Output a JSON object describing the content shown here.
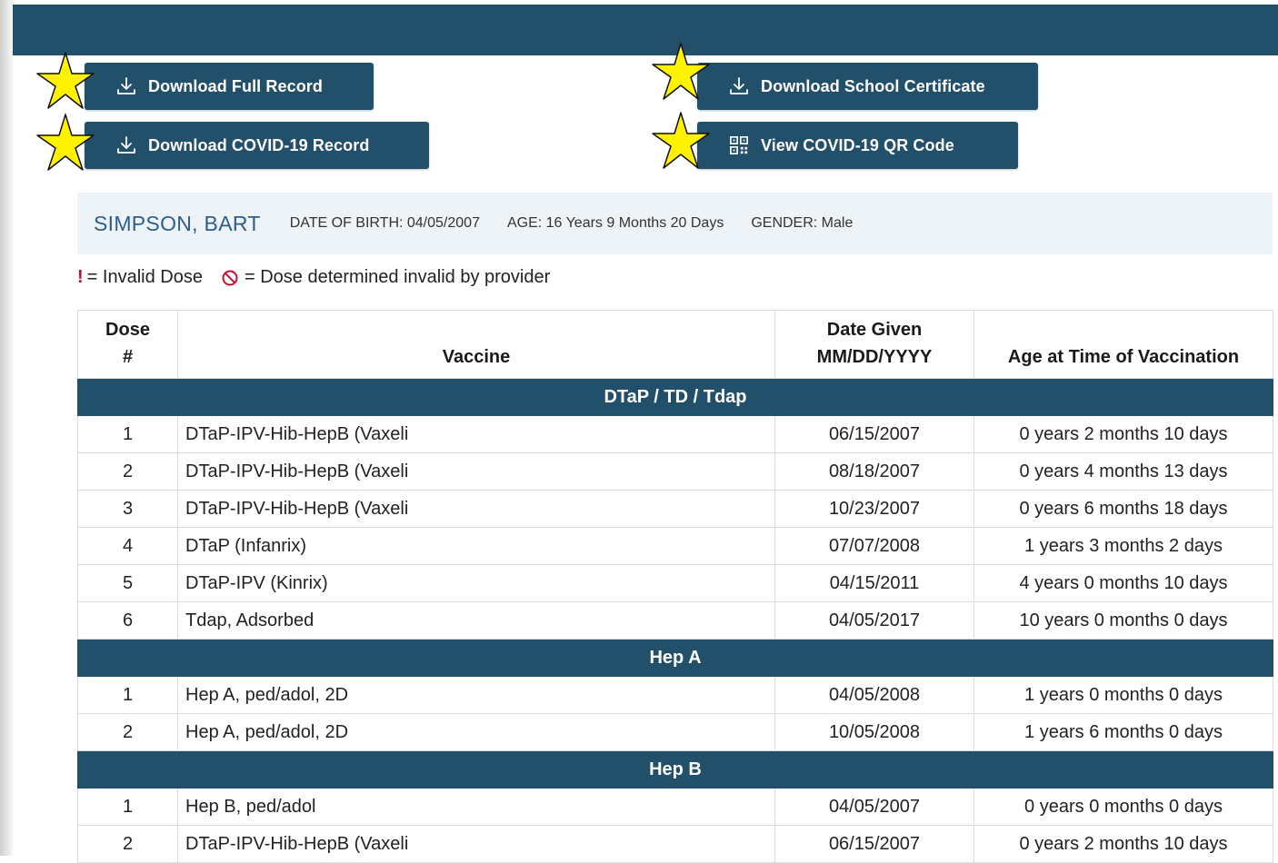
{
  "actions": {
    "download_full": "Download Full Record",
    "download_school": "Download School Certificate",
    "download_covid": "Download COVID-19 Record",
    "view_qr": "View COVID-19 QR Code"
  },
  "patient": {
    "name": "SIMPSON, BART",
    "dob": "DATE OF BIRTH: 04/05/2007",
    "age": "AGE: 16 Years 9 Months 20 Days",
    "gender": "GENDER: Male"
  },
  "legend": {
    "invalid_symbol": "!",
    "invalid_text": "= Invalid Dose",
    "provider_text": "= Dose determined invalid by provider"
  },
  "table": {
    "headers": {
      "dose_line1": "Dose",
      "dose_line2": "#",
      "vaccine": "Vaccine",
      "date_line1": "Date Given",
      "date_line2": "MM/DD/YYYY",
      "age": "Age at Time of Vaccination"
    },
    "groups": [
      {
        "name": "DTaP / TD / Tdap",
        "rows": [
          {
            "dose": "1",
            "vaccine": "DTaP-IPV-Hib-HepB (Vaxeli",
            "date": "06/15/2007",
            "age": "0 years 2 months 10 days"
          },
          {
            "dose": "2",
            "vaccine": "DTaP-IPV-Hib-HepB (Vaxeli",
            "date": "08/18/2007",
            "age": "0 years 4 months 13 days"
          },
          {
            "dose": "3",
            "vaccine": "DTaP-IPV-Hib-HepB (Vaxeli",
            "date": "10/23/2007",
            "age": "0 years 6 months 18 days"
          },
          {
            "dose": "4",
            "vaccine": "DTaP (Infanrix)",
            "date": "07/07/2008",
            "age": "1 years 3 months 2 days"
          },
          {
            "dose": "5",
            "vaccine": "DTaP-IPV (Kinrix)",
            "date": "04/15/2011",
            "age": "4 years 0 months 10 days"
          },
          {
            "dose": "6",
            "vaccine": "Tdap, Adsorbed",
            "date": "04/05/2017",
            "age": "10 years 0 months 0 days"
          }
        ]
      },
      {
        "name": "Hep A",
        "rows": [
          {
            "dose": "1",
            "vaccine": "Hep A, ped/adol, 2D",
            "date": "04/05/2008",
            "age": "1 years 0 months 0 days"
          },
          {
            "dose": "2",
            "vaccine": "Hep A, ped/adol, 2D",
            "date": "10/05/2008",
            "age": "1 years 6 months 0 days"
          }
        ]
      },
      {
        "name": "Hep B",
        "rows": [
          {
            "dose": "1",
            "vaccine": "Hep B, ped/adol",
            "date": "04/05/2007",
            "age": "0 years 0 months 0 days"
          },
          {
            "dose": "2",
            "vaccine": "DTaP-IPV-Hib-HepB (Vaxeli",
            "date": "06/15/2007",
            "age": "0 years 2 months 10 days"
          }
        ]
      }
    ]
  },
  "icons": {
    "download": "download-icon",
    "qr": "qr-code-icon",
    "star": "star-icon",
    "no_entry": "no-entry-icon"
  },
  "colors": {
    "primary": "#22506b",
    "patient_name": "#2a5f8c",
    "patient_bg": "#eef3f8",
    "star": "#fff200",
    "invalid": "#c8102e"
  }
}
